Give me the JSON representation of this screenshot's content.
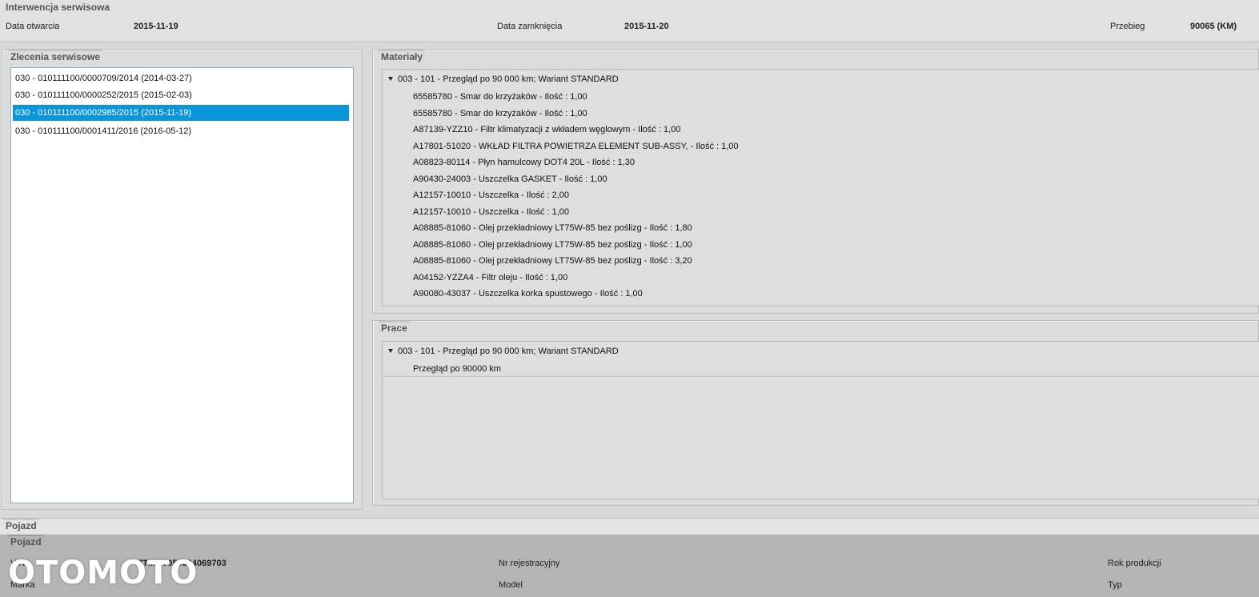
{
  "header": {
    "title": "Interwencja serwisowa",
    "open_date_label": "Data otwarcia",
    "open_date_value": "2015-11-19",
    "close_date_label": "Data zamknięcia",
    "close_date_value": "2015-11-20",
    "mileage_label": "Przebieg",
    "mileage_value": "90065 (KM)"
  },
  "orders": {
    "title": "Zlecenia serwisowe",
    "items": [
      {
        "label": "030 - 010111100/0000709/2014 (2014-03-27)",
        "selected": false
      },
      {
        "label": "030 - 010111100/0000252/2015 (2015-02-03)",
        "selected": false
      },
      {
        "label": "030 - 010111100/0002985/2015 (2015-11-19)",
        "selected": true
      },
      {
        "label": "030 - 010111100/0001411/2016 (2016-05-12)",
        "selected": false
      }
    ]
  },
  "materials": {
    "title": "Materiały",
    "group_label": "003 - 101 - Przegląd po 90 000 km; Wariant STANDARD",
    "items": [
      "65585780 - Smar do krzyżaków - Ilość : 1,00",
      "65585780 - Smar do krzyżaków - Ilość : 1,00",
      "A87139-YZZ10 - Filtr klimatyzacji z wkładem węglowym - Ilość : 1,00",
      "A17801-51020 - WKŁAD FILTRA POWIETRZA ELEMENT SUB-ASSY, - Ilość : 1,00",
      "A08823-80114 - Płyn hamulcowy DOT4 20L - Ilość : 1,30",
      "A90430-24003 - Uszczelka GASKET - Ilość : 1,00",
      "A12157-10010 - Uszczelka - Ilość : 2,00",
      "A12157-10010 - Uszczelka - Ilość : 1,00",
      "A08885-81060 - Olej przekładniowy LT75W-85 bez poślizg - Ilość : 1,80",
      "A08885-81060 - Olej przekładniowy LT75W-85 bez poślizg - Ilość : 1,00",
      "A08885-81060 - Olej przekładniowy LT75W-85 bez poślizg - Ilość : 3,20",
      "A04152-YZZA4 - Filtr oleju - Ilość : 1,00",
      "A90080-43037 - Uszczelka korka spustowego - Ilość : 1,00"
    ]
  },
  "works": {
    "title": "Prace",
    "group_label": "003 - 101 - Przegląd po 90 000 km; Wariant STANDARD",
    "items": [
      "Przegląd po 90000 km"
    ]
  },
  "vehicle": {
    "strip_title": "Pojazd",
    "panel_title": "Pojazd",
    "vin_label": "VIN",
    "vin_value": "JTMHV05J504069703",
    "brand_label": "Marka",
    "reg_label": "Nr rejestracyjny",
    "model_label": "Model",
    "year_label": "Rok produkcji",
    "type_label": "Typ"
  },
  "watermark": {
    "text": "OTOMOTO"
  },
  "colors": {
    "selection": "#0a96dc",
    "background": "#d9d9d9",
    "vehicle_area": "#b4b4b4"
  }
}
